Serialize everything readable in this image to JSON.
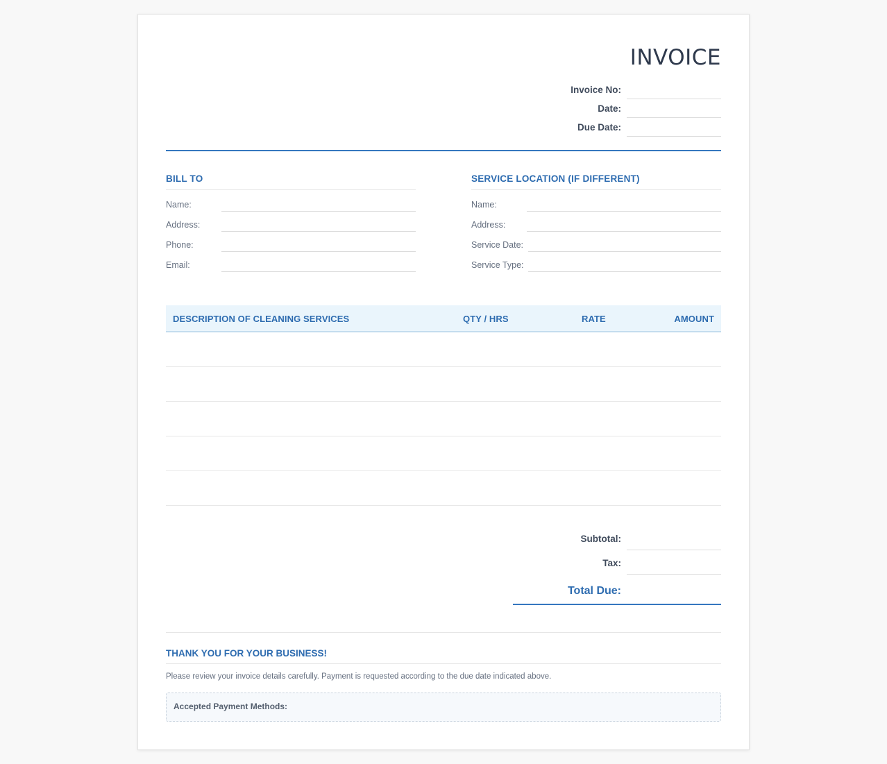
{
  "invoice": {
    "title": "INVOICE",
    "meta": [
      {
        "label": "Invoice No:",
        "value": ""
      },
      {
        "label": "Date:",
        "value": ""
      },
      {
        "label": "Due Date:",
        "value": ""
      }
    ]
  },
  "bill_to": {
    "heading": "BILL TO",
    "fields": [
      {
        "label": "Name:",
        "value": ""
      },
      {
        "label": "Address:",
        "value": ""
      },
      {
        "label": "Phone:",
        "value": ""
      },
      {
        "label": "Email:",
        "value": ""
      }
    ]
  },
  "service_location": {
    "heading": "SERVICE LOCATION (IF DIFFERENT)",
    "fields": [
      {
        "label": "Name:",
        "value": ""
      },
      {
        "label": "Address:",
        "value": ""
      },
      {
        "label": "Service Date:",
        "value": ""
      },
      {
        "label": "Service Type:",
        "value": ""
      }
    ]
  },
  "table": {
    "columns": [
      "DESCRIPTION OF CLEANING SERVICES",
      "QTY / HRS",
      "RATE",
      "AMOUNT"
    ],
    "rows": [
      [
        "",
        "",
        "",
        ""
      ],
      [
        "",
        "",
        "",
        ""
      ],
      [
        "",
        "",
        "",
        ""
      ],
      [
        "",
        "",
        "",
        ""
      ],
      [
        "",
        "",
        "",
        ""
      ]
    ]
  },
  "totals": {
    "subtotal_label": "Subtotal:",
    "tax_label": "Tax:",
    "total_due_label": "Total Due:"
  },
  "footer": {
    "thanks": "THANK YOU FOR YOUR BUSINESS!",
    "note": "Please review your invoice details carefully. Payment is requested according to the due date indicated above.",
    "payment_methods_label": "Accepted Payment Methods:"
  },
  "colors": {
    "accent": "#2e6cb0",
    "header_fill": "#eaf5fc",
    "page_background": "#f8f8f8"
  }
}
